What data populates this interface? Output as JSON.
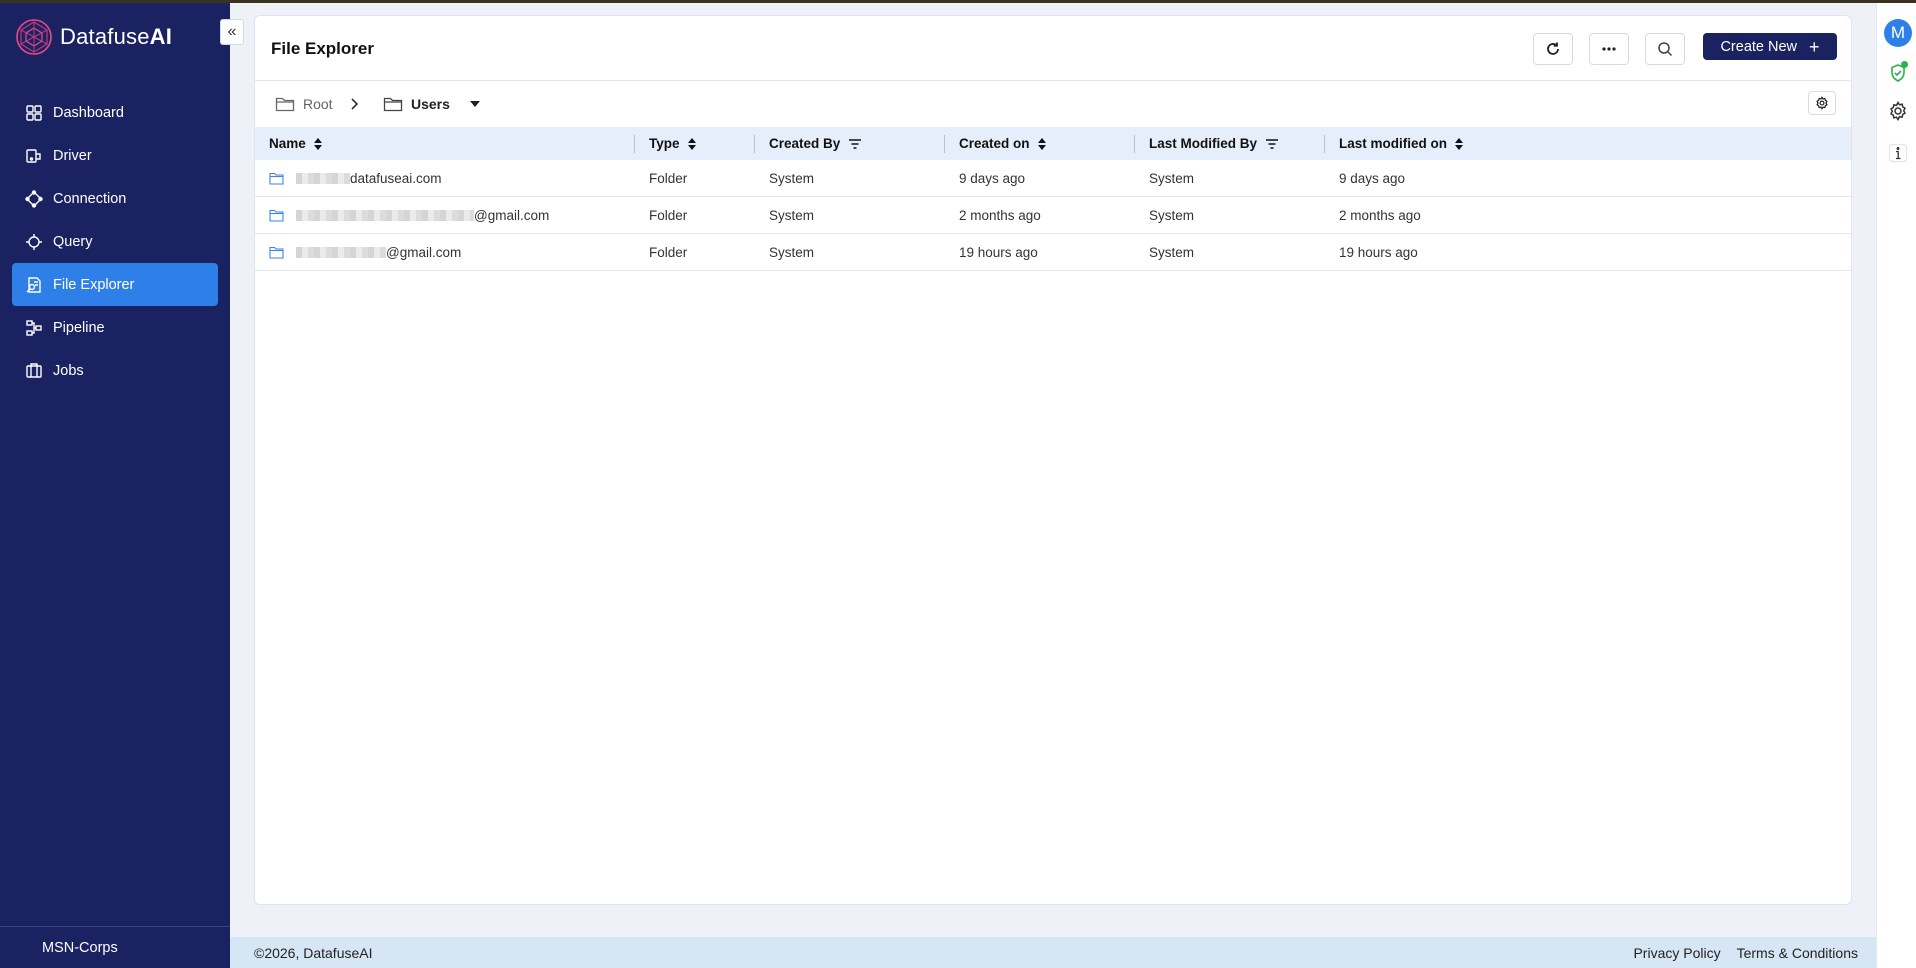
{
  "app": {
    "brand_prefix": "Datafuse",
    "brand_suffix": "AI",
    "org": "MSN-Corps",
    "avatar_initial": "M"
  },
  "sidebar": {
    "items": [
      {
        "label": "Dashboard",
        "icon": "grid-icon"
      },
      {
        "label": "Driver",
        "icon": "driver-icon"
      },
      {
        "label": "Connection",
        "icon": "connection-icon"
      },
      {
        "label": "Query",
        "icon": "query-icon"
      },
      {
        "label": "File Explorer",
        "icon": "file-explorer-icon",
        "active": true
      },
      {
        "label": "Pipeline",
        "icon": "pipeline-icon"
      },
      {
        "label": "Jobs",
        "icon": "jobs-icon"
      }
    ]
  },
  "header": {
    "title": "File Explorer",
    "create_label": "Create New"
  },
  "breadcrumb": {
    "root": "Root",
    "current": "Users"
  },
  "table": {
    "columns": [
      "Name",
      "Type",
      "Created By",
      "Created on",
      "Last Modified By",
      "Last modified on"
    ],
    "rows": [
      {
        "name": "datafuseai.com",
        "type": "Folder",
        "created_by": "System",
        "created_on": "9 days ago",
        "modified_by": "System",
        "modified_on": "9 days ago"
      },
      {
        "name": "@gmail.com",
        "type": "Folder",
        "created_by": "System",
        "created_on": "2 months ago",
        "modified_by": "System",
        "modified_on": "2 months ago"
      },
      {
        "name": "@gmail.com",
        "type": "Folder",
        "created_by": "System",
        "created_on": "19 hours ago",
        "modified_by": "System",
        "modified_on": "19 hours ago"
      }
    ]
  },
  "footer": {
    "copyright": "©2026, DatafuseAI",
    "privacy": "Privacy Policy",
    "terms": "Terms & Conditions"
  },
  "colors": {
    "sidebar_bg": "#1a2261",
    "accent": "#2f7fe8",
    "table_header_bg": "#e6eefb",
    "footer_bg": "#d6e6f4"
  }
}
